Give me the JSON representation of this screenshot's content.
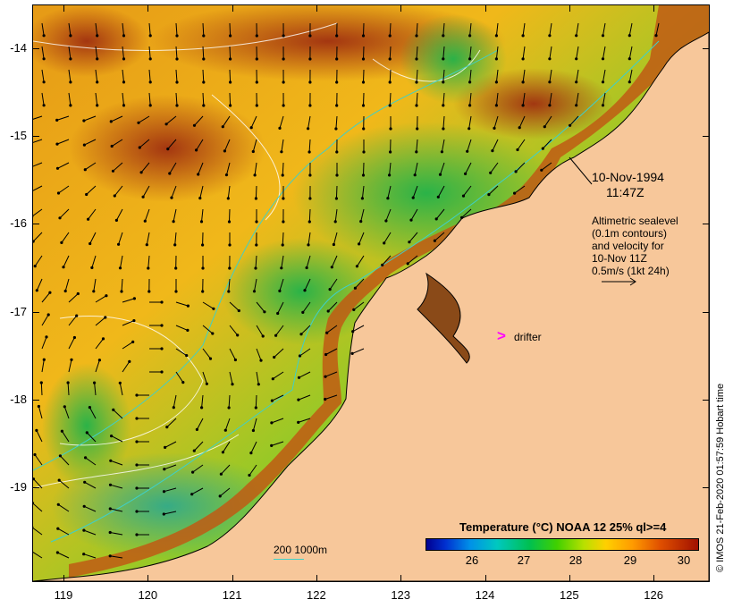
{
  "y_ticks": [
    {
      "label": "-14",
      "lat": -14
    },
    {
      "label": "-15",
      "lat": -15
    },
    {
      "label": "-16",
      "lat": -16
    },
    {
      "label": "-17",
      "lat": -17
    },
    {
      "label": "-18",
      "lat": -18
    },
    {
      "label": "-19",
      "lat": -19
    }
  ],
  "x_ticks": [
    {
      "label": "119",
      "lon": 119
    },
    {
      "label": "120",
      "lon": 120
    },
    {
      "label": "121",
      "lon": 121
    },
    {
      "label": "122",
      "lon": 122
    },
    {
      "label": "123",
      "lon": 123
    },
    {
      "label": "124",
      "lon": 124
    },
    {
      "label": "125",
      "lon": 125
    },
    {
      "label": "126",
      "lon": 126
    }
  ],
  "date_line1": "10-Nov-1994",
  "date_line2": "11:47Z",
  "legend_lines": [
    "Altimetric sealevel",
    "(0.1m contours)",
    "and velocity for",
    "10-Nov 11Z",
    "0.5m/s (1kt 24h)"
  ],
  "drifter_label": "drifter",
  "isobath_key": "200  1000m",
  "colorbar_title": "Temperature (°C) NOAA 12 25% ql>=4",
  "colorbar_ticks": [
    "26",
    "27",
    "28",
    "29",
    "30"
  ],
  "credit": "© IMOS 21-Feb-2020 01:57:59 Hobart time",
  "colors": {
    "land": "#f7c79a",
    "isobath": "#3fd0c8",
    "drifter": "#ff00ff",
    "contour": "#ffffff"
  }
}
